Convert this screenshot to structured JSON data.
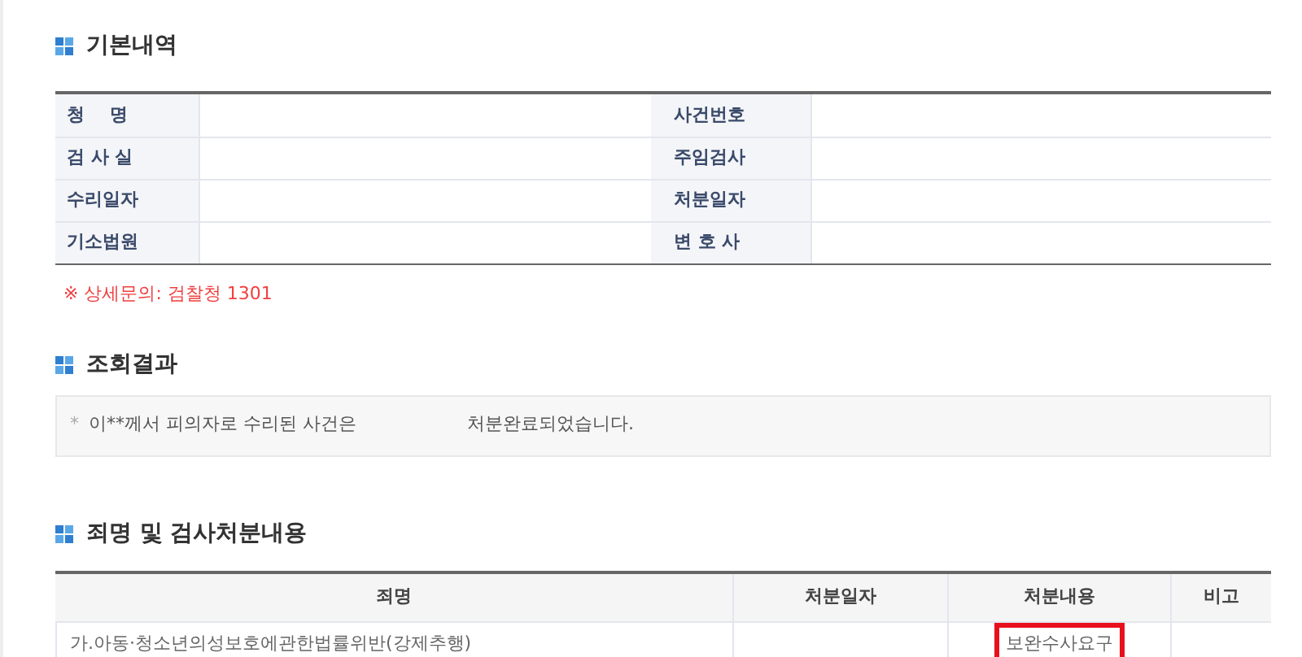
{
  "basic": {
    "title": "기본내역",
    "rows": [
      {
        "label_1": "청    명",
        "label_2": "사건번호"
      },
      {
        "label_1": "검 사 실",
        "label_2": "주임검사"
      },
      {
        "label_1": "수리일자",
        "label_2": "처분일자"
      },
      {
        "label_1": "기소법원",
        "label_2": "변 호 사"
      }
    ],
    "note": "※ 상세문의: 검찰청 1301"
  },
  "result": {
    "title": "조회결과",
    "bullet": "*",
    "text_before": "이**께서 피의자로 수리된 사건은",
    "text_after": "처분완료되었습니다."
  },
  "disposition": {
    "title": "죄명 및 검사처분내용",
    "columns": [
      "죄명",
      "처분일자",
      "처분내용",
      "비고"
    ],
    "rows": [
      {
        "crime": "가.아동·청소년의성보호에관한법률위반(강제추행)",
        "disposition": "보완수사요구",
        "disposition_highlighted": true
      }
    ]
  }
}
